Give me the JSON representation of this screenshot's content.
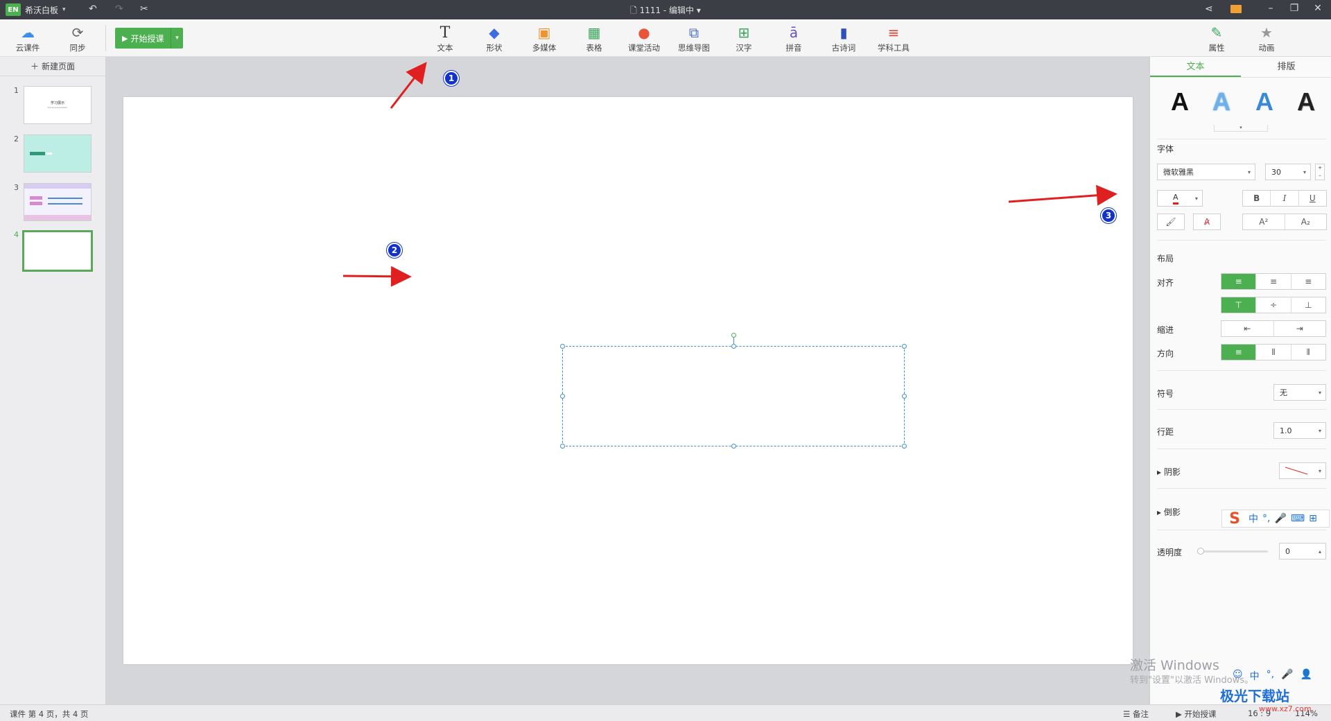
{
  "titlebar": {
    "logo": "EN",
    "app_name": "希沃白板",
    "doc_title": "1111 - 编辑中"
  },
  "toolbar": {
    "cloud_label": "云课件",
    "sync_label": "同步",
    "start_label": "开始授课",
    "tools": [
      "文本",
      "形状",
      "多媒体",
      "表格",
      "课堂活动",
      "思维导图",
      "汉字",
      "拼音",
      "古诗词",
      "学科工具"
    ],
    "props_label": "属性",
    "anim_label": "动画"
  },
  "slides_panel": {
    "new_page": "新建页面",
    "numbers": [
      "1",
      "2",
      "3",
      "4"
    ],
    "thumb1_title": "学习展示",
    "thumb1_sub": "Visual presentation",
    "selected": 4
  },
  "props": {
    "tab_text": "文本",
    "tab_layout": "排版",
    "font_section": "字体",
    "font_name": "微软雅黑",
    "font_size": "30",
    "layout_section": "布局",
    "align_label": "对齐",
    "indent_label": "缩进",
    "direction_label": "方向",
    "symbol_label": "符号",
    "symbol_value": "无",
    "line_spacing_label": "行距",
    "line_spacing_value": "1.0",
    "shadow_label": "阴影",
    "reflection_label": "倒影",
    "opacity_label": "透明度",
    "opacity_value": "0",
    "style_letter": "A",
    "bold": "B",
    "italic": "I",
    "underline": "U"
  },
  "annotations": [
    "1",
    "2",
    "3"
  ],
  "statusbar": {
    "page_info": "课件 第 4 页，共 4 页",
    "notes": "备注",
    "start": "开始授课",
    "ratio": "16 : 9",
    "zoom": "114%"
  },
  "overlay": {
    "activate_title": "激活 Windows",
    "activate_sub": "转到\"设置\"以激活 Windows。",
    "ime_text": "中",
    "brand": "极光下载站",
    "brand_url": "www.xz7.com"
  },
  "colors": {
    "accent": "#4caf50",
    "annotation_arrow": "#e02020",
    "annotation_marker": "#1232c8"
  }
}
